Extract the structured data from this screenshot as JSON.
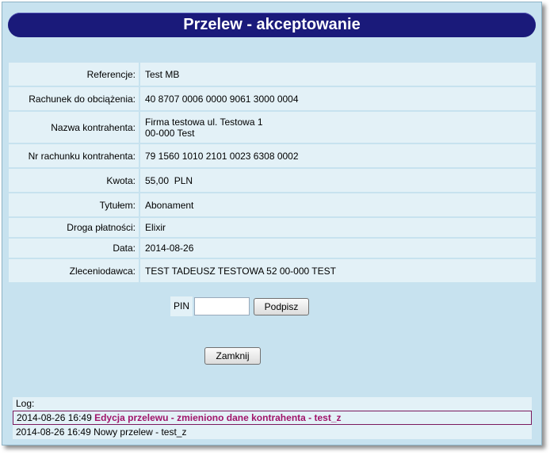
{
  "title": "Przelew - akceptowanie",
  "fields": [
    {
      "label": "Referencje:",
      "value": "Test MB"
    },
    {
      "label": "Rachunek do obciążenia:",
      "value": "40 8707 0006 0000 9061 3000 0004"
    },
    {
      "label": "Nazwa kontrahenta:",
      "value_lines": [
        "Firma testowa ul. Testowa 1",
        "00-000 Test"
      ]
    },
    {
      "label": "Nr rachunku kontrahenta:",
      "value": "79 1560 1010 2101 0023 6308 0002"
    },
    {
      "label": "Kwota:",
      "value": "55,00  PLN"
    },
    {
      "label": "Tytułem:",
      "value": "Abonament"
    },
    {
      "label": "Droga płatności:",
      "value": "Elixir"
    },
    {
      "label": "Data:",
      "value": "2014-08-26"
    },
    {
      "label": "Zleceniodawca:",
      "value": "TEST TADEUSZ TESTOWA 52 00-000 TEST"
    }
  ],
  "pin": {
    "label": "PIN",
    "value": "",
    "sign_label": "Podpisz"
  },
  "close_label": "Zamknij",
  "log": {
    "header": "Log:",
    "entries": [
      {
        "time": "2014-08-26 16:49",
        "message": "Edycja przelewu - zmieniono dane kontrahenta - test_z",
        "highlight": true
      },
      {
        "time": "2014-08-26 16:49",
        "message": "Nowy przelew - test_z",
        "highlight": false
      }
    ]
  }
}
